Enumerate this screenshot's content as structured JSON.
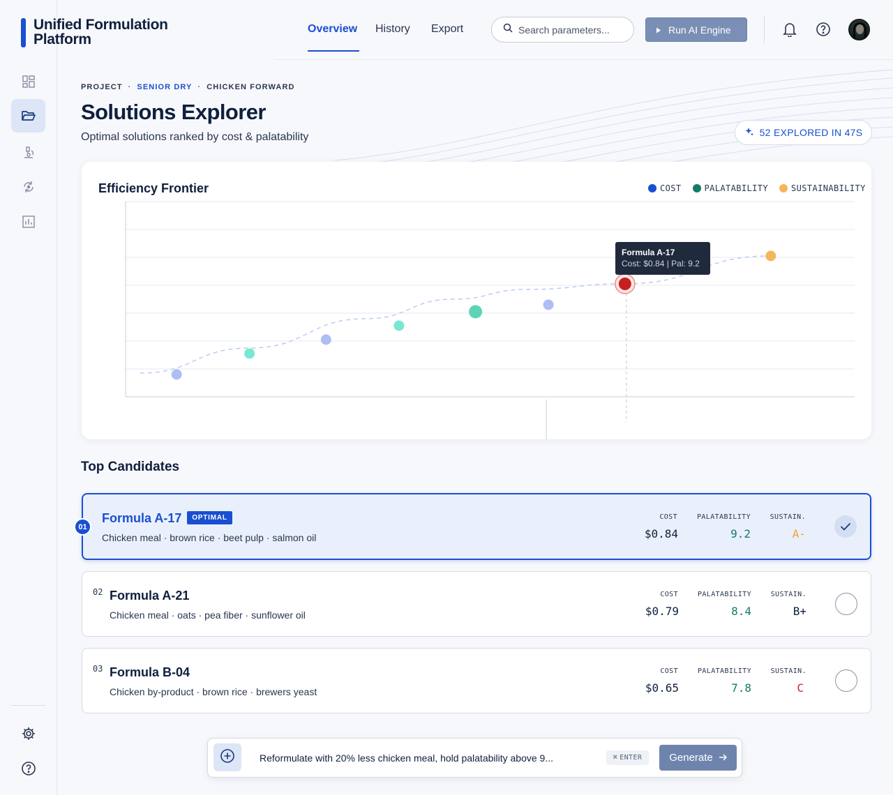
{
  "app": {
    "brand_line1": "Unified Formulation",
    "brand_line2": "Platform"
  },
  "nav": {
    "tabs": [
      {
        "label": "Overview",
        "active": true
      },
      {
        "label": "History",
        "active": false
      },
      {
        "label": "Export",
        "active": false
      }
    ],
    "search_placeholder": "Search parameters...",
    "run_button": "Run AI Engine"
  },
  "sidebar": {
    "items": [
      {
        "icon": "dashboard-icon",
        "active": false
      },
      {
        "icon": "folder-open-icon",
        "active": true
      },
      {
        "icon": "microscope-icon",
        "active": false
      },
      {
        "icon": "cycle-icon",
        "active": false
      },
      {
        "icon": "bar-chart-icon",
        "active": false
      }
    ],
    "bottom": [
      {
        "icon": "settings-gear-icon"
      },
      {
        "icon": "help-icon"
      }
    ]
  },
  "breadcrumb": {
    "items": [
      "PROJECT",
      "SENIOR DRY",
      "CHICKEN FORWARD"
    ],
    "accent_index": 1
  },
  "page": {
    "title": "Solutions Explorer",
    "subtitle": "Optimal solutions ranked by cost & palatability",
    "explored_badge": "52 EXPLORED IN 47S"
  },
  "chart": {
    "title": "Efficiency Frontier",
    "legend": [
      {
        "label": "COST",
        "color": "#1a4fd1"
      },
      {
        "label": "PALATABILITY",
        "color": "#157a68"
      },
      {
        "label": "SUSTAINABILITY",
        "color": "#f7b55a"
      }
    ],
    "tooltip": {
      "title": "Formula A-17",
      "detail": "Cost: $0.84 | Pal: 9.2"
    }
  },
  "chart_data": {
    "type": "scatter",
    "title": "Efficiency Frontier",
    "xlabel": "",
    "ylabel": "",
    "grid": true,
    "legend_placement": "top-right",
    "ylim": [
      0,
      7
    ],
    "xlim": [
      0,
      10
    ],
    "series": [
      {
        "name": "COST",
        "points": [
          {
            "x": 0.7,
            "y": 0.8
          },
          {
            "x": 2.75,
            "y": 2.05
          },
          {
            "x": 5.8,
            "y": 3.3
          }
        ]
      },
      {
        "name": "PALATABILITY",
        "points": [
          {
            "x": 1.7,
            "y": 1.55
          },
          {
            "x": 3.75,
            "y": 2.55
          },
          {
            "x": 4.8,
            "y": 3.05
          }
        ]
      },
      {
        "name": "SUSTAINABILITY",
        "points": [
          {
            "x": 8.85,
            "y": 5.05
          }
        ]
      }
    ],
    "highlight": {
      "label": "Formula A-17",
      "x": 6.85,
      "y": 4.05
    },
    "frontier": [
      {
        "x": 0.2,
        "y": 0.85
      },
      {
        "x": 1.7,
        "y": 1.75
      },
      {
        "x": 3.3,
        "y": 2.8
      },
      {
        "x": 4.5,
        "y": 3.5
      },
      {
        "x": 5.5,
        "y": 3.85
      },
      {
        "x": 6.85,
        "y": 4.05
      },
      {
        "x": 8.85,
        "y": 5.05
      }
    ]
  },
  "candidates": {
    "title": "Top Candidates",
    "items": [
      {
        "rank": "01",
        "name": "Formula A-17",
        "badge": "OPTIMAL",
        "ingredients": "Chicken meal · brown rice · beet pulp · salmon oil",
        "cost_label": "COST",
        "cost": "$0.84",
        "pal_label": "PALATABILITY",
        "pal": "9.2",
        "sus_label": "SUSTAIN.",
        "sus": "A-",
        "sus_color": "#f2a03d",
        "selected": true
      },
      {
        "rank": "02",
        "name": "Formula A-21",
        "badge": "",
        "ingredients": "Chicken meal · oats · pea fiber · sunflower oil",
        "cost_label": "COST",
        "cost": "$0.79",
        "pal_label": "PALATABILITY",
        "pal": "8.4",
        "sus_label": "SUSTAIN.",
        "sus": "B+",
        "sus_color": "#0f1f3d",
        "selected": false
      },
      {
        "rank": "03",
        "name": "Formula B-04",
        "badge": "",
        "ingredients": "Chicken by-product · brown rice · brewers yeast",
        "cost_label": "COST",
        "cost": "$0.65",
        "pal_label": "PALATABILITY",
        "pal": "7.8",
        "sus_label": "SUSTAIN.",
        "sus": "C",
        "sus_color": "#c62828",
        "selected": false
      }
    ]
  },
  "prompt": {
    "text": "Reformulate with 20% less chicken meal, hold palatability above 9...",
    "shortcut": "ENTER",
    "generate": "Generate"
  }
}
